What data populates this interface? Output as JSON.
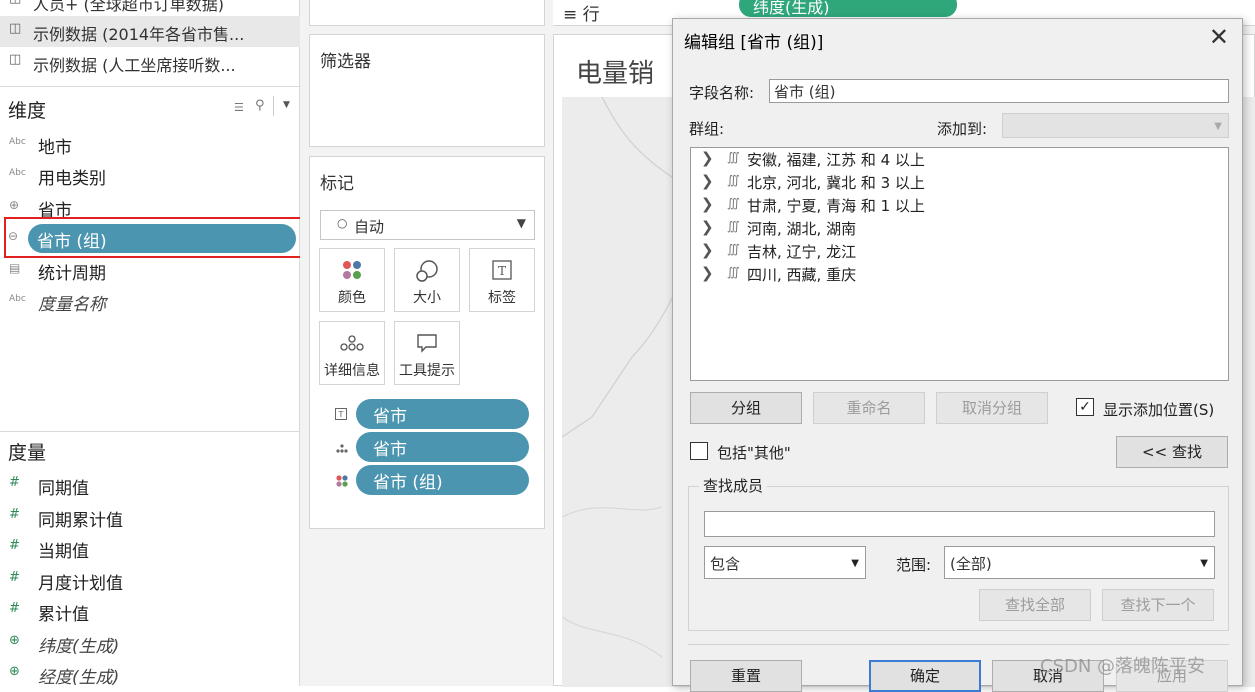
{
  "datasources": [
    {
      "icon": "cylinder-icon",
      "label": "人员+ (全球超市订单数据)",
      "selected": false
    },
    {
      "icon": "datasource-active-icon",
      "label": "示例数据 (2014年各省市售...",
      "selected": true
    },
    {
      "icon": "cylinder-icon",
      "label": "示例数据 (人工坐席接听数...",
      "selected": false
    }
  ],
  "dimensions": {
    "title": "维度",
    "fields": [
      {
        "type": "Abc",
        "label": "地市"
      },
      {
        "type": "Abc",
        "label": "用电类别"
      },
      {
        "type": "globe",
        "label": "省市"
      },
      {
        "type": "group",
        "label": "省市 (组)"
      },
      {
        "type": "date",
        "label": "统计周期"
      },
      {
        "type": "Abc",
        "label": "度量名称"
      }
    ]
  },
  "measures": {
    "title": "度量",
    "fields": [
      {
        "type": "#",
        "label": "同期值"
      },
      {
        "type": "#",
        "label": "同期累计值"
      },
      {
        "type": "#",
        "label": "当期值"
      },
      {
        "type": "#",
        "label": "月度计划值"
      },
      {
        "type": "#",
        "label": "累计值"
      },
      {
        "type": "geo",
        "label": "纬度(生成)"
      },
      {
        "type": "geo",
        "label": "经度(生成)"
      }
    ]
  },
  "filters_card": {
    "title": "筛选器"
  },
  "marks_card": {
    "title": "标记",
    "mark_type": "自动",
    "buttons": [
      {
        "icon": "color-icon",
        "label": "颜色"
      },
      {
        "icon": "size-icon",
        "label": "大小"
      },
      {
        "icon": "label-icon",
        "label": "标签"
      },
      {
        "icon": "detail-icon",
        "label": "详细信息"
      },
      {
        "icon": "tooltip-icon",
        "label": "工具提示"
      }
    ],
    "pills": [
      {
        "icon": "label-icon",
        "label": "省市"
      },
      {
        "icon": "detail-icon",
        "label": "省市"
      },
      {
        "icon": "color-icon",
        "label": "省市 (组)"
      }
    ]
  },
  "shelf": {
    "label": "行",
    "pill": "纬度(生成)"
  },
  "view": {
    "title": "电量销"
  },
  "dialog": {
    "title": "编辑组 [省市 (组)]",
    "field_name_label": "字段名称:",
    "field_name_value": "省市 (组)",
    "groups_label": "群组:",
    "add_to_label": "添加到:",
    "add_to_value": "",
    "groups": [
      "安徽, 福建, 江苏 和 4 以上",
      "北京, 河北, 冀北 和 3 以上",
      "甘肃, 宁夏, 青海 和 1 以上",
      "河南, 湖北, 湖南",
      "吉林, 辽宁, 龙江",
      "四川, 西藏, 重庆"
    ],
    "group_button": "分组",
    "rename_button": "重命名",
    "ungroup_button": "取消分组",
    "show_add_location_label": "显示添加位置(S)",
    "show_add_location_checked": true,
    "include_other_label": "包括\"其他\"",
    "include_other_checked": false,
    "find_toggle_button": "<< 查找",
    "find_members_label": "查找成员",
    "find_input_value": "",
    "match_mode": "包含",
    "scope_label": "范围:",
    "scope_value": "(全部)",
    "find_all_button": "查找全部",
    "find_next_button": "查找下一个",
    "reset_button": "重置",
    "ok_button": "确定",
    "cancel_button": "取消",
    "apply_button": "应用"
  },
  "watermark": "CSDN @落魄陈平安"
}
